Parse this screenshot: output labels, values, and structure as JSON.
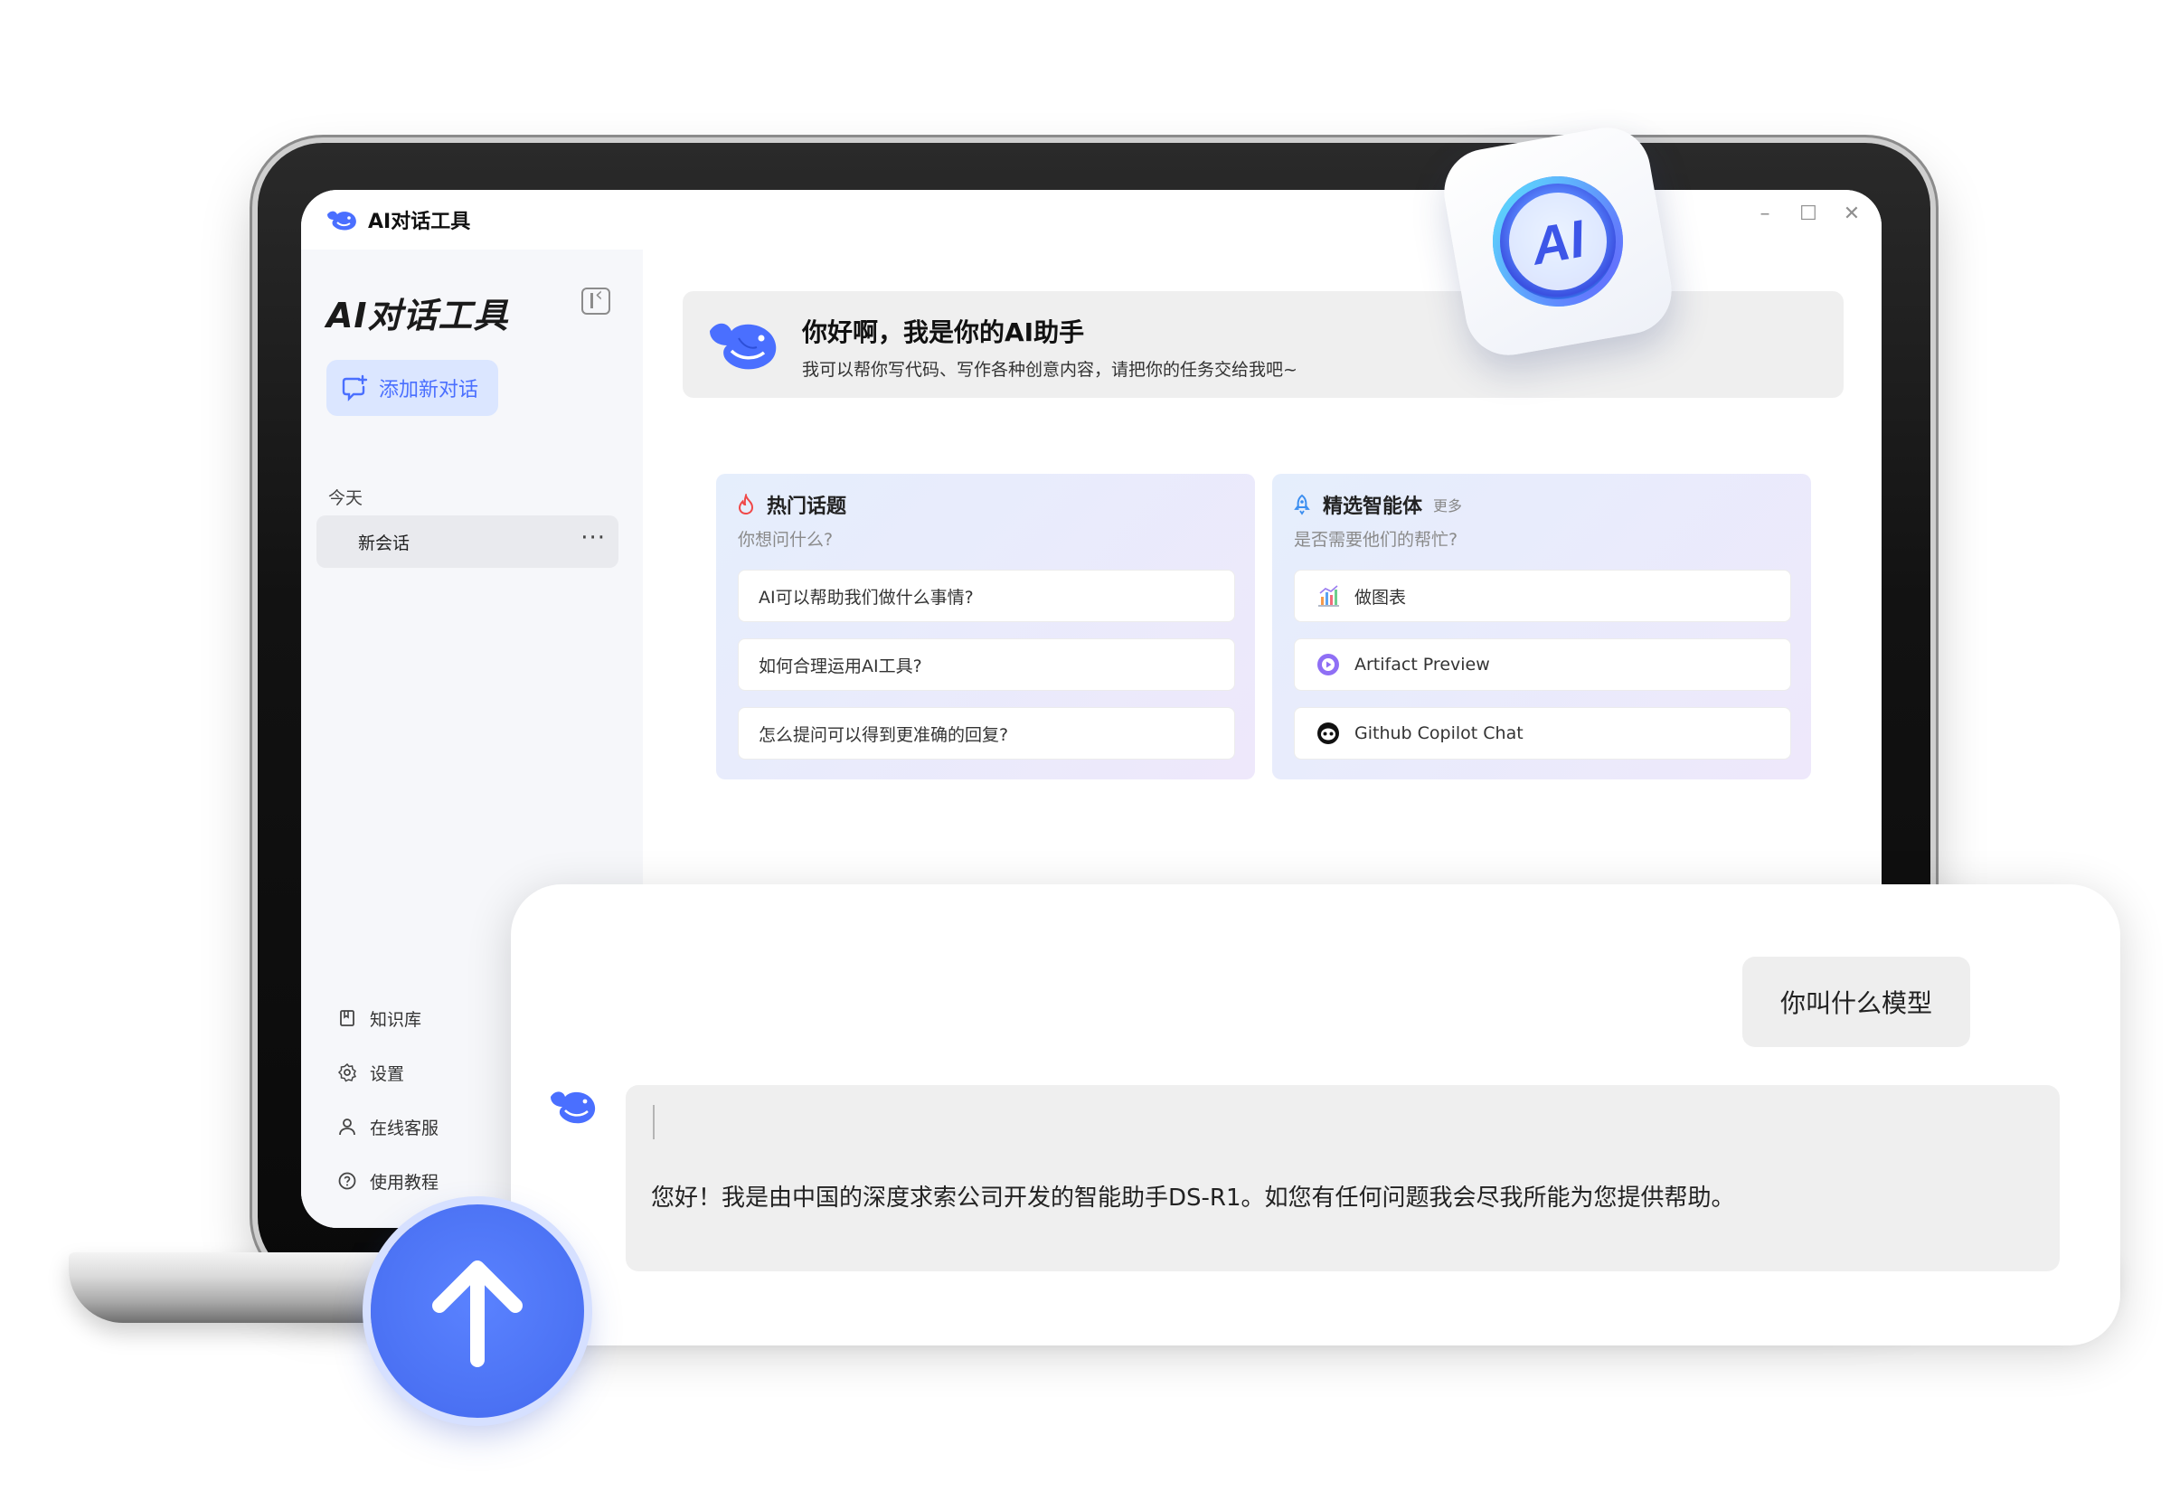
{
  "window": {
    "title": "AI对话工具",
    "controls": [
      "minimize-icon",
      "maximize-icon",
      "close-icon"
    ]
  },
  "sidebar": {
    "brand": "AI对话工具",
    "new_chat_label": "添加新对话",
    "section_today": "今天",
    "sessions": [
      {
        "label": "新会话"
      }
    ],
    "session_more": "···",
    "nav": [
      {
        "icon": "book-icon",
        "label": "知识库"
      },
      {
        "icon": "gear-icon",
        "label": "设置"
      },
      {
        "icon": "user-icon",
        "label": "在线客服"
      },
      {
        "icon": "help-icon",
        "label": "使用教程"
      }
    ]
  },
  "welcome": {
    "title": "你好啊，我是你的AI助手",
    "subtitle": "我可以帮你写代码、写作各种创意内容，请把你的任务交给我吧~"
  },
  "hot_topics": {
    "icon": "fire-icon",
    "title": "热门话题",
    "subtitle": "你想问什么?",
    "items": [
      "AI可以帮助我们做什么事情?",
      "如何合理运用AI工具?",
      "怎么提问可以得到更准确的回复?"
    ]
  },
  "agents": {
    "icon": "rocket-icon",
    "title": "精选智能体",
    "more": "更多",
    "subtitle": "是否需要他们的帮忙?",
    "items": [
      {
        "icon": "chart-icon",
        "label": "做图表"
      },
      {
        "icon": "play-icon",
        "label": "Artifact Preview"
      },
      {
        "icon": "github-icon",
        "label": "Github Copilot Chat"
      }
    ]
  },
  "badge": {
    "text": "AI"
  },
  "chat": {
    "user_message": "你叫什么模型",
    "bot_message": "您好！我是由中国的深度求索公司开发的智能助手DS-R1。如您有任何问题我会尽我所能为您提供帮助。"
  },
  "colors": {
    "accent": "#4a6fff",
    "button_blue": "#4d74f5",
    "new_chat_bg": "#dbe6ff",
    "panel_gradient_start": "#e5eefc",
    "panel_gradient_end": "#eee8fb"
  }
}
